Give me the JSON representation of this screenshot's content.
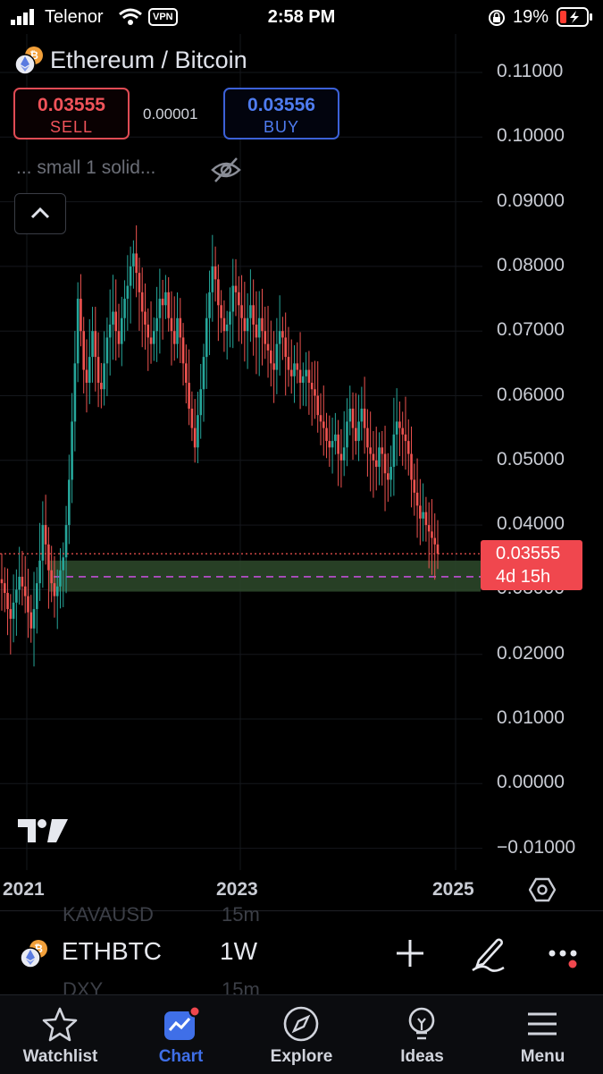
{
  "status_bar": {
    "carrier": "Telenor",
    "vpn": "VPN",
    "time": "2:58 PM",
    "battery": "19%"
  },
  "header": {
    "title": "Ethereum / Bitcoin",
    "sell": {
      "price": "0.03555",
      "label": "SELL"
    },
    "spread": "0.00001",
    "buy": {
      "price": "0.03556",
      "label": "BUY"
    },
    "indicator_label": "...   small 1 solid..."
  },
  "colors": {
    "up": "#26a69a",
    "down": "#ef5350",
    "sell": "#f0535a",
    "buy": "#4f7cf0",
    "zone": "#2e4a2c",
    "accent": "#3f6fe8"
  },
  "chart_data": {
    "type": "candlestick",
    "symbol": "ETHBTC",
    "interval": "1W",
    "y_ticks": [
      "0.11000",
      "0.10000",
      "0.09000",
      "0.08000",
      "0.07000",
      "0.06000",
      "0.05000",
      "0.04000",
      "0.03000",
      "0.02000",
      "0.01000",
      "0.00000",
      "−0.01000"
    ],
    "y_range": [
      -0.01,
      0.11
    ],
    "x_ticks": [
      "2021",
      "2023",
      "2025"
    ],
    "last_price": "0.03555",
    "countdown": "4d 15h",
    "support_zone": [
      0.0297,
      0.0345
    ],
    "dashed_level": 0.032,
    "close_series": [
      0.031,
      0.0295,
      0.027,
      0.0255,
      0.028,
      0.03,
      0.032,
      0.0305,
      0.029,
      0.0265,
      0.024,
      0.027,
      0.031,
      0.0345,
      0.04,
      0.037,
      0.033,
      0.031,
      0.029,
      0.0305,
      0.033,
      0.035,
      0.04,
      0.047,
      0.056,
      0.065,
      0.075,
      0.07,
      0.064,
      0.062,
      0.066,
      0.07,
      0.066,
      0.062,
      0.061,
      0.065,
      0.069,
      0.071,
      0.073,
      0.07,
      0.068,
      0.072,
      0.075,
      0.077,
      0.08,
      0.082,
      0.079,
      0.076,
      0.073,
      0.071,
      0.069,
      0.068,
      0.07,
      0.072,
      0.075,
      0.074,
      0.076,
      0.072,
      0.07,
      0.068,
      0.072,
      0.069,
      0.065,
      0.062,
      0.058,
      0.055,
      0.052,
      0.057,
      0.061,
      0.066,
      0.072,
      0.076,
      0.08,
      0.078,
      0.074,
      0.072,
      0.07,
      0.071,
      0.073,
      0.077,
      0.076,
      0.074,
      0.072,
      0.07,
      0.072,
      0.074,
      0.071,
      0.069,
      0.072,
      0.07,
      0.068,
      0.067,
      0.065,
      0.064,
      0.068,
      0.07,
      0.069,
      0.066,
      0.064,
      0.063,
      0.065,
      0.064,
      0.062,
      0.063,
      0.064,
      0.062,
      0.061,
      0.06,
      0.057,
      0.056,
      0.055,
      0.053,
      0.052,
      0.053,
      0.054,
      0.051,
      0.05,
      0.052,
      0.056,
      0.058,
      0.055,
      0.053,
      0.056,
      0.058,
      0.055,
      0.052,
      0.051,
      0.05,
      0.049,
      0.052,
      0.051,
      0.048,
      0.047,
      0.049,
      0.054,
      0.056,
      0.055,
      0.054,
      0.053,
      0.051,
      0.047,
      0.045,
      0.043,
      0.041,
      0.042,
      0.04,
      0.039,
      0.038,
      0.037,
      0.03555
    ]
  },
  "symbol_bar": {
    "symbol": "ETHBTC",
    "interval": "1W",
    "ghost_rows": [
      {
        "sym": "KAVAUSD",
        "tf": "15m"
      },
      {
        "sym": "DXY",
        "tf": "15m"
      }
    ]
  },
  "tabs": [
    {
      "label": "Watchlist",
      "icon": "star-icon"
    },
    {
      "label": "Chart",
      "icon": "chart-icon"
    },
    {
      "label": "Explore",
      "icon": "compass-icon"
    },
    {
      "label": "Ideas",
      "icon": "lightbulb-icon"
    },
    {
      "label": "Menu",
      "icon": "menu-icon"
    }
  ]
}
